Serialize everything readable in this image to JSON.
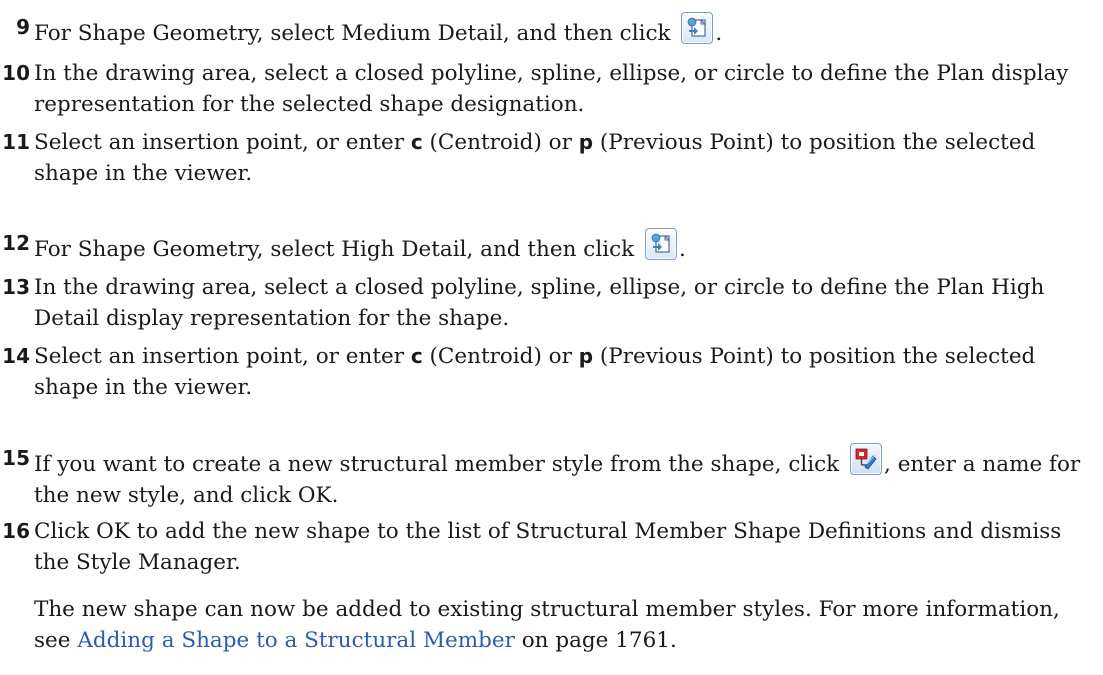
{
  "steps": [
    {
      "num": "9",
      "text_a": "For Shape Geometry, select Medium Detail, and then click",
      "text_b": "."
    },
    {
      "num": "10",
      "text": "In the drawing area, select a closed polyline, spline, ellipse, or circle to define the Plan display representation for the selected shape designation."
    },
    {
      "num": "11",
      "t1": "Select an insertion point, or enter",
      "k1": "c",
      "t2": "(Centroid) or",
      "k2": "p",
      "t3": "(Previous Point) to position the selected shape in the viewer."
    },
    {
      "num": "12",
      "text_a": "For Shape Geometry, select High Detail, and then click",
      "text_b": "."
    },
    {
      "num": "13",
      "text": "In the drawing area, select a closed polyline, spline, ellipse, or circle to define the Plan High Detail display representation for the shape."
    },
    {
      "num": "14",
      "t1": "Select an insertion point, or enter",
      "k1": "c",
      "t2": "(Centroid) or",
      "k2": "p",
      "t3": "(Previous Point) to position the selected shape in the viewer."
    },
    {
      "num": "15",
      "text_a": "If you want to create a new structural member style from the shape, click",
      "text_b": ", enter a name for the new style, and click OK."
    },
    {
      "num": "16",
      "text": "Click OK to add the new shape to the list of Structural Member Shape Definitions and dismiss the Style Manager."
    }
  ],
  "note": {
    "text_a": "The new shape can now be added to existing structural member styles. For more information, see",
    "link": "Adding a Shape to a Structural Member",
    "text_b": "on page 1761."
  },
  "icons": {
    "select_geometry": "select-geometry-icon",
    "create_style": "create-member-style-icon"
  },
  "colors": {
    "link": "#2a5db0",
    "text": "#1a1a1a"
  }
}
